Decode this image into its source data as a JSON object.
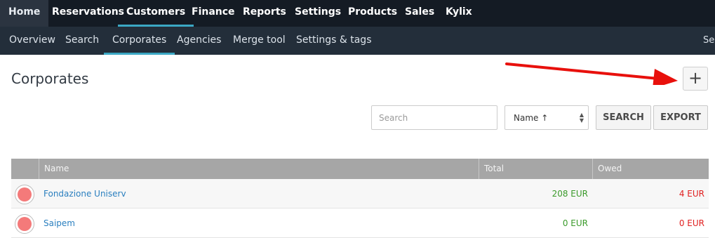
{
  "top_nav": {
    "items": [
      "Home",
      "Reservations",
      "Customers",
      "Finance",
      "Reports",
      "Settings",
      "Products",
      "Sales",
      "Kylix"
    ],
    "active": "Customers"
  },
  "sub_nav": {
    "items": [
      "Overview",
      "Search",
      "Corporates",
      "Agencies",
      "Merge tool",
      "Settings & tags"
    ],
    "active": "Corporates",
    "truncated_right": "Sea"
  },
  "page": {
    "title": "Corporates",
    "add_symbol": "+"
  },
  "toolbar": {
    "search_placeholder": "Search",
    "search_value": "",
    "sort_value": "Name ↑",
    "search_button": "SEARCH",
    "export_button": "EXPORT"
  },
  "table": {
    "columns": [
      "Name",
      "Total",
      "Owed"
    ],
    "rows": [
      {
        "name": "Fondazione Uniserv",
        "total": "208 EUR",
        "owed": "4 EUR"
      },
      {
        "name": "Saipem",
        "total": "0 EUR",
        "owed": "0 EUR"
      }
    ]
  },
  "colors": {
    "topnav_bg": "#141b24",
    "subnav_bg": "#232e3a",
    "accent": "#3ba8c4",
    "annotation_arrow": "#e8100c",
    "status_dot": "#f47a7a",
    "total_text": "#3a9a2a",
    "owed_text": "#e02020",
    "link_text": "#2a7fbf"
  },
  "icons": {
    "add": "plus-icon",
    "sort_caret": "chevron-updown-icon",
    "row_status": "status-dot-icon",
    "annotation": "arrow-annotation"
  }
}
